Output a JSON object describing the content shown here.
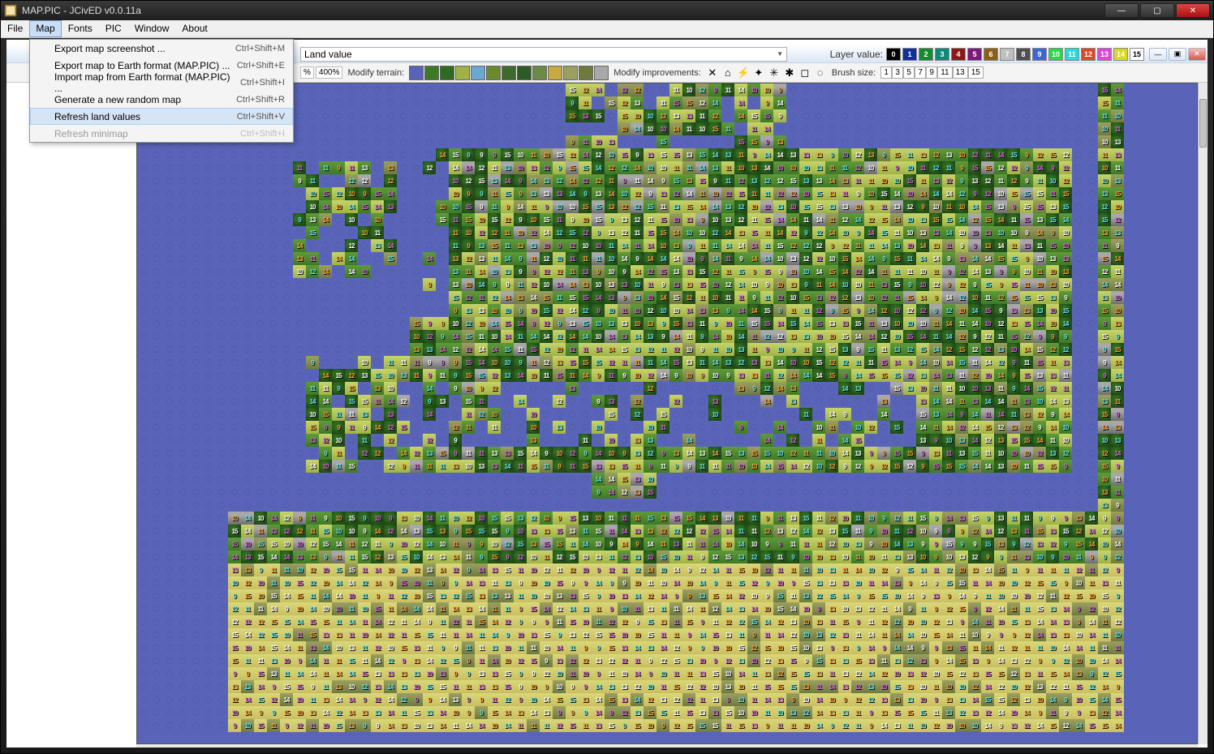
{
  "window": {
    "title": "MAP.PIC - JCivED v0.0.11a"
  },
  "menubar": [
    "File",
    "Map",
    "Fonts",
    "PIC",
    "Window",
    "About"
  ],
  "menubar_open_index": 1,
  "dropdown": [
    {
      "label": "Export map screenshot ...",
      "shortcut": "Ctrl+Shift+M",
      "enabled": true,
      "hover": false
    },
    {
      "label": "Export map to Earth format (MAP.PIC) ...",
      "shortcut": "Ctrl+Shift+E",
      "enabled": true,
      "hover": false
    },
    {
      "label": "Import map from Earth format (MAP.PIC) ...",
      "shortcut": "Ctrl+Shift+I",
      "enabled": true,
      "hover": false
    },
    {
      "label": "Generate a new random map",
      "shortcut": "Ctrl+Shift+R",
      "enabled": true,
      "hover": false
    },
    {
      "label": "Refresh land values",
      "shortcut": "Ctrl+Shift+V",
      "enabled": true,
      "hover": true
    },
    {
      "label": "Refresh minimap",
      "shortcut": "Ctrl+Shift+I",
      "enabled": false,
      "hover": false
    }
  ],
  "child": {
    "combo_value": "Land value",
    "layer_value_label": "Layer value:",
    "layer_values": [
      0,
      1,
      2,
      3,
      4,
      5,
      6,
      7,
      8,
      9,
      10,
      11,
      12,
      13,
      14,
      15
    ],
    "layer_colors": [
      "#000000",
      "#12309a",
      "#168a2e",
      "#0e8a7a",
      "#8a1a1a",
      "#7a1a7a",
      "#8a6018",
      "#bfbfbf",
      "#505050",
      "#3a66d8",
      "#2ad84a",
      "#2ad8d8",
      "#d84a2a",
      "#d84ad8",
      "#d8d82a",
      "#ffffff"
    ]
  },
  "toolbar": {
    "zoom_remainder_label": "%",
    "zoom_selected": "400%",
    "modify_terrain_label": "Modify terrain:",
    "terrain_colors": [
      "#5964b8",
      "#3e7a26",
      "#2f6a20",
      "#9fb245",
      "#6aa8d0",
      "#6a8a2e",
      "#3e6a2e",
      "#2e5a26",
      "#6a8a46",
      "#c8a840",
      "#9aa060",
      "#6f7a3f",
      "#a8a8a8"
    ],
    "modify_improvements_label": "Modify improvements:",
    "improvement_glyphs": [
      "✕",
      "⌂",
      "⚡",
      "✦",
      "✳",
      "✱",
      "◻",
      "◌"
    ],
    "improvement_glyph_names": [
      "clear-icon",
      "city-icon",
      "fortress-icon",
      "road-icon",
      "railroad-icon",
      "irrigation-icon",
      "mine-icon",
      "pollution-icon"
    ],
    "brush_size_label": "Brush size:",
    "brush_sizes": [
      1,
      3,
      5,
      7,
      9,
      11,
      13,
      15
    ]
  }
}
